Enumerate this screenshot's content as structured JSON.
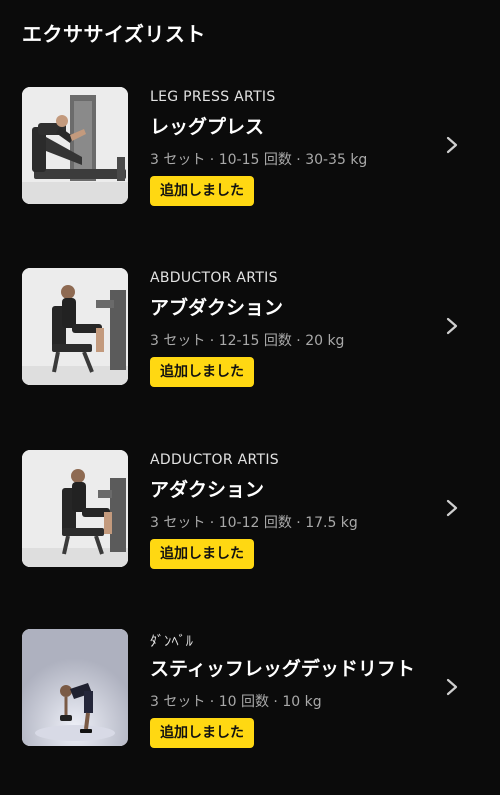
{
  "header": {
    "title": "エクササイズリスト"
  },
  "exercises": [
    {
      "subtitle": "LEG PRESS ARTIS",
      "name": "レッグプレス",
      "details": "3 セット · 10-15 回数 · 30-35 kg",
      "badge": "追加しました",
      "thumbnail_icon": "leg-press-machine"
    },
    {
      "subtitle": "ABDUCTOR ARTIS",
      "name": "アブダクション",
      "details": "3 セット · 12-15 回数 · 20 kg",
      "badge": "追加しました",
      "thumbnail_icon": "abductor-machine"
    },
    {
      "subtitle": "ADDUCTOR ARTIS",
      "name": "アダクション",
      "details": "3 セット · 10-12 回数 · 17.5 kg",
      "badge": "追加しました",
      "thumbnail_icon": "adductor-machine"
    },
    {
      "subtitle": "ﾀﾞﾝﾍﾞﾙ",
      "name": "スティッフレッグデッドリフト",
      "details": "3 セット · 10 回数 · 10 kg",
      "badge": "追加しました",
      "thumbnail_icon": "dumbbell-deadlift"
    }
  ],
  "colors": {
    "background": "#0b0b0b",
    "badge": "#ffd812",
    "details_text": "#a9a9a9"
  },
  "icons": {
    "row_arrow": "chevron-right-icon"
  }
}
